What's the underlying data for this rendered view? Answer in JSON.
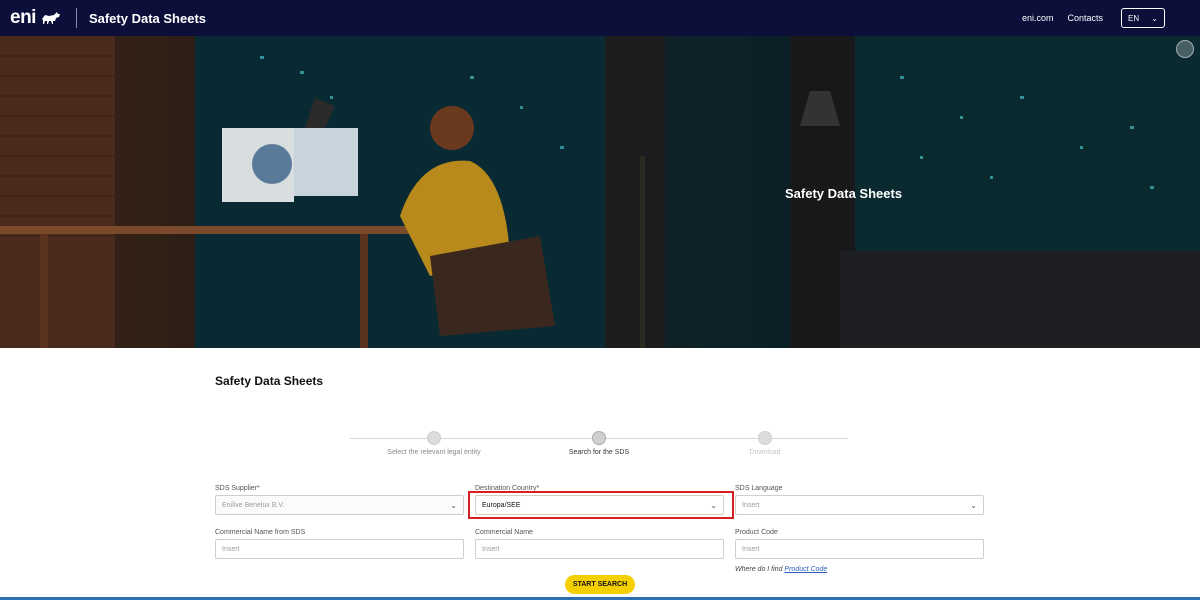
{
  "header": {
    "logo_text": "eni",
    "title": "Safety Data Sheets",
    "links": [
      "eni.com",
      "Contacts"
    ],
    "language": "EN",
    "bg_color": "#0b0f3a"
  },
  "hero": {
    "title": "Safety Data Sheets"
  },
  "main": {
    "title": "Safety Data Sheets",
    "steps": [
      {
        "label": "Select the relevant legal entity",
        "state": "done"
      },
      {
        "label": "Search for the SDS",
        "state": "active"
      },
      {
        "label": "Download",
        "state": "future"
      }
    ],
    "fields": {
      "supplier": {
        "label": "SDS Supplier*",
        "value": "Enilive Benelux B.V."
      },
      "country": {
        "label": "Destination Country*",
        "value": "Europa/SEE"
      },
      "language": {
        "label": "SDS Language",
        "placeholder": "Insert"
      },
      "commercial_name_sds": {
        "label": "Commercial Name from SDS",
        "placeholder": "Insert"
      },
      "commercial_name": {
        "label": "Commercial Name",
        "placeholder": "Insert"
      },
      "product_code": {
        "label": "Product Code",
        "placeholder": "Insert"
      }
    },
    "help_prefix": "Where do I find",
    "help_link": "Product Code",
    "start_button": "START SEARCH",
    "button_color": "#f5d000",
    "highlight_color": "#d42020"
  }
}
